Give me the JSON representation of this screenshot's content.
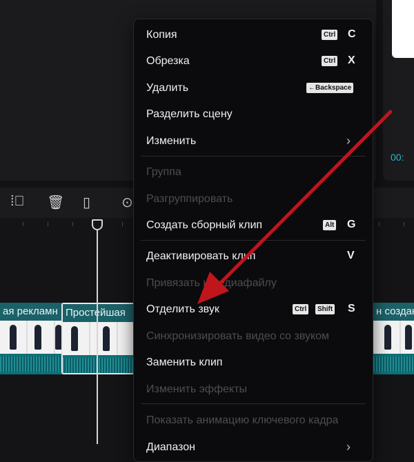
{
  "right_panel": {
    "timecode": "00:"
  },
  "timeline": {
    "clips": [
      {
        "label": "ая рекламн"
      },
      {
        "label": "Простейшая"
      },
      {
        "label": "н создан"
      }
    ]
  },
  "context_menu": {
    "items": [
      {
        "label": "Копия",
        "enabled": true,
        "shortcut": [
          "Ctrl"
        ],
        "key": "C"
      },
      {
        "label": "Обрезка",
        "enabled": true,
        "shortcut": [
          "Ctrl"
        ],
        "key": "X"
      },
      {
        "label": "Удалить",
        "enabled": true,
        "shortcut": [
          "←Backspace"
        ],
        "key": ""
      },
      {
        "label": "Разделить сцену",
        "enabled": true
      },
      {
        "label": "Изменить",
        "enabled": true,
        "submenu_icon": "chevron-right-icon"
      },
      {
        "label": "Группа",
        "enabled": false
      },
      {
        "label": "Разгруппировать",
        "enabled": false
      },
      {
        "label": "Создать сборный клип",
        "enabled": true,
        "shortcut": [
          "Alt"
        ],
        "key": "G"
      },
      {
        "label": "Деактивировать клип",
        "enabled": true,
        "key": "V"
      },
      {
        "label": "Привязать к медиафайлу",
        "enabled": false
      },
      {
        "label": "Отделить звук",
        "enabled": true,
        "shortcut": [
          "Ctrl",
          "Shift"
        ],
        "key": "S"
      },
      {
        "label": "Синхронизировать видео со звуком",
        "enabled": false
      },
      {
        "label": "Заменить клип",
        "enabled": true
      },
      {
        "label": "Изменить эффекты",
        "enabled": false
      },
      {
        "label": "Показать анимацию ключевого кадра",
        "enabled": false
      },
      {
        "label": "Диапазон",
        "enabled": true,
        "submenu_icon": "chevron-right-icon"
      }
    ]
  },
  "colors": {
    "accent_teal": "#0f6f78",
    "annotation_arrow": "#c0151b",
    "menu_bg": "#0b0b0d"
  }
}
